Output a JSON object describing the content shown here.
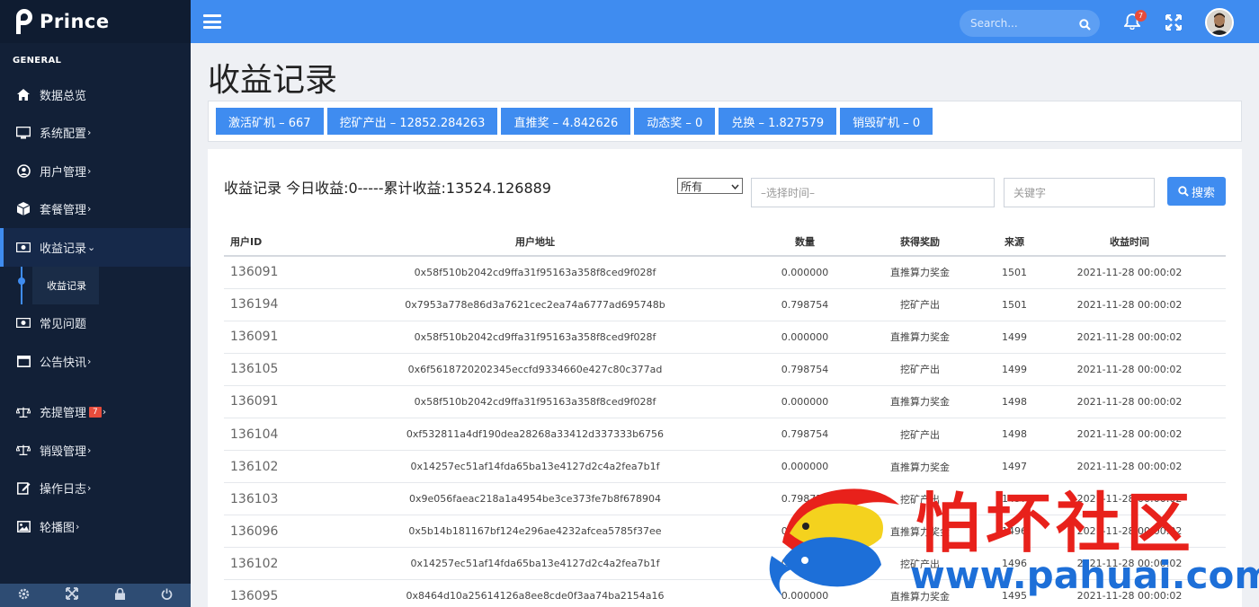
{
  "brand": {
    "name": "Prince"
  },
  "sidebar": {
    "section": "GENERAL",
    "items": [
      {
        "label": "数据总览",
        "icon": "home-icon",
        "chevron": ""
      },
      {
        "label": "系统配置",
        "icon": "monitor-icon",
        "chevron": "›"
      },
      {
        "label": "用户管理",
        "icon": "user-circle-icon",
        "chevron": "›"
      },
      {
        "label": "套餐管理",
        "icon": "cube-icon",
        "chevron": "›"
      },
      {
        "label": "收益记录",
        "icon": "money-icon",
        "chevron": "⌄"
      },
      {
        "label": "常见问题",
        "icon": "money-icon",
        "chevron": ""
      },
      {
        "label": "公告快讯",
        "icon": "window-icon",
        "chevron": "›"
      },
      {
        "label": "充提管理",
        "icon": "balance-scale-icon",
        "chevron": "›",
        "badge": "7"
      },
      {
        "label": "销毁管理",
        "icon": "balance-scale-icon",
        "chevron": "›"
      },
      {
        "label": "操作日志",
        "icon": "edit-icon",
        "chevron": "›"
      },
      {
        "label": "轮播图",
        "icon": "image-icon",
        "chevron": "›"
      }
    ],
    "sub_item": "收益记录",
    "footer_icons": [
      "settings-icon",
      "fullscreen-icon",
      "lock-icon",
      "power-icon"
    ]
  },
  "topbar": {
    "search_placeholder": "Search...",
    "notification_count": "7"
  },
  "page": {
    "title": "收益记录",
    "stats": [
      "激活矿机 – 667",
      "挖矿产出 – 12852.284263",
      "直推奖 – 4.842626",
      "动态奖 – 0",
      "兑换 – 1.827579",
      "销毁矿机 – 0"
    ],
    "summary": "收益记录 今日收益:0-----累计收益:13524.126889",
    "filter_select": "所有",
    "date_placeholder": "–选择时间–",
    "keyword_placeholder": "关键字",
    "search_button": "搜索"
  },
  "table": {
    "headers": [
      "用户ID",
      "用户地址",
      "数量",
      "获得奖励",
      "来源",
      "收益时间"
    ],
    "rows": [
      [
        "136091",
        "0x58f510b2042cd9ffa31f95163a358f8ced9f028f",
        "0.000000",
        "直推算力奖金",
        "1501",
        "2021-11-28 00:00:02"
      ],
      [
        "136194",
        "0x7953a778e86d3a7621cec2ea74a6777ad695748b",
        "0.798754",
        "挖矿产出",
        "1501",
        "2021-11-28 00:00:02"
      ],
      [
        "136091",
        "0x58f510b2042cd9ffa31f95163a358f8ced9f028f",
        "0.000000",
        "直推算力奖金",
        "1499",
        "2021-11-28 00:00:02"
      ],
      [
        "136105",
        "0x6f5618720202345eccfd9334660e427c80c377ad",
        "0.798754",
        "挖矿产出",
        "1499",
        "2021-11-28 00:00:02"
      ],
      [
        "136091",
        "0x58f510b2042cd9ffa31f95163a358f8ced9f028f",
        "0.000000",
        "直推算力奖金",
        "1498",
        "2021-11-28 00:00:02"
      ],
      [
        "136104",
        "0xf532811a4df190dea28268a33412d337333b6756",
        "0.798754",
        "挖矿产出",
        "1498",
        "2021-11-28 00:00:02"
      ],
      [
        "136102",
        "0x14257ec51af14fda65ba13e4127d2c4a2fea7b1f",
        "0.000000",
        "直推算力奖金",
        "1497",
        "2021-11-28 00:00:02"
      ],
      [
        "136103",
        "0x9e056faeac218a1a4954be3ce373fe7b8f678904",
        "0.798754",
        "挖矿产出",
        "1497",
        "2021-11-28 00:00:02"
      ],
      [
        "136096",
        "0x5b14b181167bf124e296ae4232afcea5785f37ee",
        "0.000000",
        "直推算力奖金",
        "1496",
        "2021-11-28 00:00:02"
      ],
      [
        "136102",
        "0x14257ec51af14fda65ba13e4127d2c4a2fea7b1f",
        "0.798754",
        "挖矿产出",
        "1496",
        "2021-11-28 00:00:02"
      ],
      [
        "136095",
        "0x8464d10a25614126a8ee8cde0f3aa74ba2154a16",
        "0.000000",
        "直推算力奖金",
        "1495",
        "2021-11-28 00:00:02"
      ]
    ]
  },
  "watermark": {
    "text": "怕坏社区",
    "url": "www.pahuai.com"
  }
}
